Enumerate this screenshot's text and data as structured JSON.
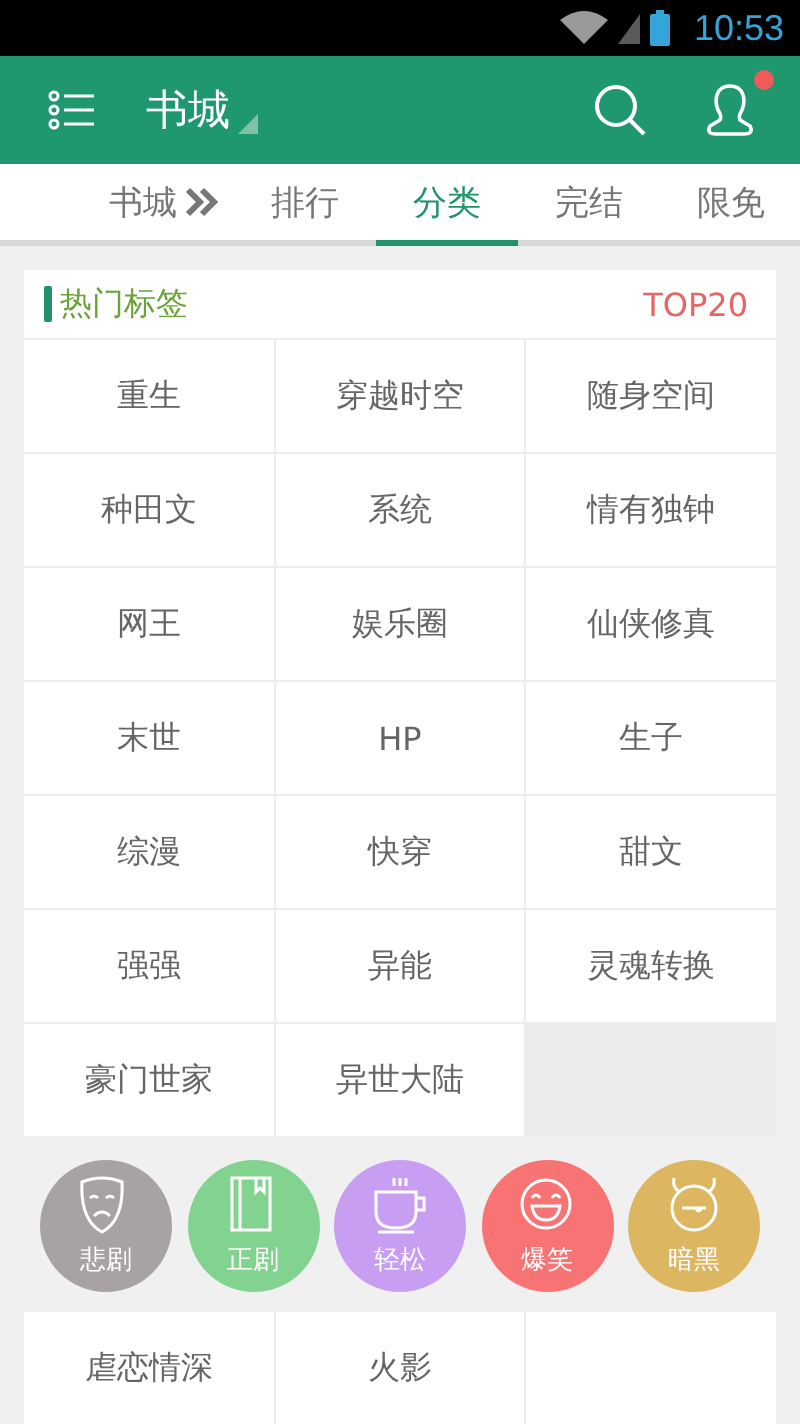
{
  "status_bar": {
    "time": "10:53"
  },
  "header": {
    "title": "书城",
    "has_notification": true
  },
  "tabs": [
    {
      "label": "书城",
      "kind": "more",
      "selected": false
    },
    {
      "label": "排行",
      "kind": "plain",
      "selected": false
    },
    {
      "label": "分类",
      "kind": "plain",
      "selected": true
    },
    {
      "label": "完结",
      "kind": "plain",
      "selected": false
    },
    {
      "label": "限免",
      "kind": "plain",
      "selected": false
    }
  ],
  "hot_tags": {
    "title": "热门标签",
    "badge": "TOP20",
    "tags": [
      "重生",
      "穿越时空",
      "随身空间",
      "种田文",
      "系统",
      "情有独钟",
      "网王",
      "娱乐圈",
      "仙侠修真",
      "末世",
      "HP",
      "生子",
      "综漫",
      "快穿",
      "甜文",
      "强强",
      "异能",
      "灵魂转换",
      "豪门世家",
      "异世大陆"
    ]
  },
  "moods": [
    {
      "label": "悲剧",
      "kind": "mask",
      "color": "#a9a2a2"
    },
    {
      "label": "正剧",
      "kind": "book",
      "color": "#82d390"
    },
    {
      "label": "轻松",
      "kind": "cup",
      "color": "#c79ef2"
    },
    {
      "label": "爆笑",
      "kind": "laugh",
      "color": "#f87373"
    },
    {
      "label": "暗黑",
      "kind": "devil",
      "color": "#dcb660"
    }
  ],
  "more_tags": [
    "虐恋情深",
    "火影"
  ]
}
